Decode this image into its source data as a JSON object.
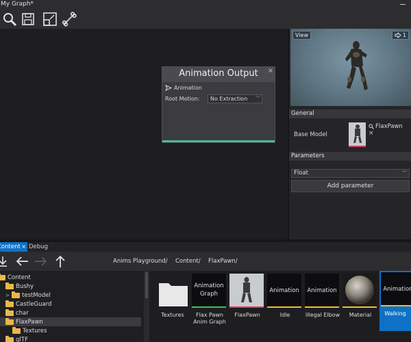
{
  "window": {
    "title": "My Graph*"
  },
  "toolbar": {
    "icons": [
      "search-icon",
      "save-icon",
      "resize-icon",
      "bone-icon"
    ]
  },
  "node": {
    "title": "Animation Output",
    "close": "×",
    "animation_label": "Animation",
    "root_motion_label": "Root Motion:",
    "root_motion_value": "No Extraction"
  },
  "preview": {
    "view_label": "View",
    "camera_count": "1"
  },
  "general": {
    "header": "General",
    "base_model_label": "Base Model",
    "base_model_value": "FlaxPawn",
    "clear": "×"
  },
  "parameters": {
    "header": "Parameters",
    "type_value": "Float",
    "add_button": "Add parameter"
  },
  "tabs": {
    "content": "Content",
    "debug": "Debug",
    "close": "×"
  },
  "breadcrumb": [
    "Anims Playground/",
    "Content/",
    "FlaxPawn/"
  ],
  "tree": [
    {
      "label": "Content",
      "level": 0,
      "expander": ""
    },
    {
      "label": "Bushy",
      "level": 1,
      "expander": ""
    },
    {
      "label": "testModel",
      "level": 2,
      "expander": ">"
    },
    {
      "label": "CastleGuard",
      "level": 1,
      "expander": ""
    },
    {
      "label": "char",
      "level": 1,
      "expander": ""
    },
    {
      "label": "FlaxPawn",
      "level": 1,
      "expander": ""
    },
    {
      "label": "Textures",
      "level": 2,
      "expander": ""
    },
    {
      "label": "glTF",
      "level": 1,
      "expander": ""
    }
  ],
  "assets": [
    {
      "name": "Textures",
      "box_text": ""
    },
    {
      "name": "Flax Pawn Anim Graph",
      "box_text": "Animation Graph"
    },
    {
      "name": "FlaxPawn",
      "box_text": ""
    },
    {
      "name": "Idle",
      "box_text": "Animation"
    },
    {
      "name": "Illegal Elbow",
      "box_text": "Animation"
    },
    {
      "name": "Material",
      "box_text": ""
    },
    {
      "name": "Walking",
      "box_text": "Animation"
    }
  ],
  "colors": {
    "accent": "#0e71c6",
    "node_bottom": "#4db6a0",
    "folder": "#e8b84a",
    "anim_border": "#e8c040",
    "graph_border": "#40c060",
    "model_border": "#d04060",
    "material_border": "#e8c040"
  }
}
